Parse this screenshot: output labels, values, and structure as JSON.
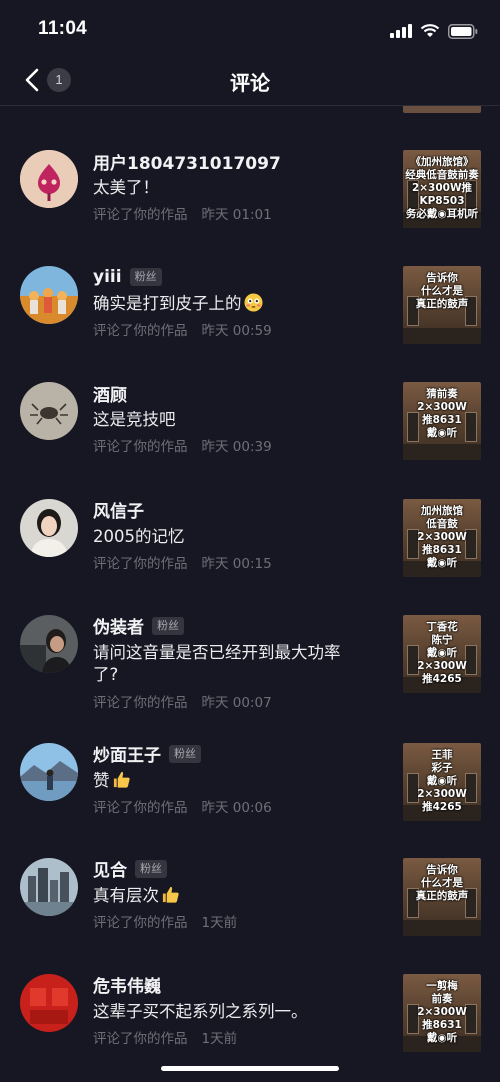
{
  "status_bar": {
    "time": "11:04"
  },
  "nav": {
    "title": "评论",
    "back_count": "1"
  },
  "comments": [
    {
      "name": "用户1804731017097",
      "fan": "",
      "text": "太美了！",
      "action": "评论了你的作品",
      "time": "昨天 01:01",
      "thumb_caption": "《加州旅馆》\n经典低音鼓前奏\n2×300W推KP8503\n务必戴◉耳机听"
    },
    {
      "name": "yiii",
      "fan": "粉丝",
      "text": "确实是打到皮子上的",
      "action": "评论了你的作品",
      "time": "昨天 00:59",
      "thumb_caption": "告诉你\n什么才是\n真正的鼓声"
    },
    {
      "name": "酒顾",
      "fan": "",
      "text": "这是竞技吧",
      "action": "评论了你的作品",
      "time": "昨天 00:39",
      "thumb_caption": "猜前奏\n2×300W\n推8631\n戴◉听"
    },
    {
      "name": "风信子",
      "fan": "",
      "text": "2005的记忆",
      "action": "评论了你的作品",
      "time": "昨天 00:15",
      "thumb_caption": "加州旅馆\n低音鼓\n2×300W\n推8631\n戴◉听"
    },
    {
      "name": "伪装者",
      "fan": "粉丝",
      "text": "请问这音量是否已经开到最大功率了?",
      "action": "评论了你的作品",
      "time": "昨天 00:07",
      "thumb_caption": "丁香花\n陈宁\n戴◉听\n2×300W\n推4265"
    },
    {
      "name": "炒面王子",
      "fan": "粉丝",
      "text": "赞",
      "action": "评论了你的作品",
      "time": "昨天 00:06",
      "thumb_caption": "王菲\n彩子\n戴◉听\n2×300W\n推4265"
    },
    {
      "name": "见合",
      "fan": "粉丝",
      "text": "真有层次",
      "action": "评论了你的作品",
      "time": "1天前",
      "thumb_caption": "告诉你\n什么才是\n真正的鼓声"
    },
    {
      "name": "危韦伟巍",
      "fan": "",
      "text": "这辈子买不起系列之系列一。",
      "action": "评论了你的作品",
      "time": "1天前",
      "thumb_caption": "一剪梅\n前奏\n2×300W\n推8631\n戴◉听"
    }
  ],
  "colors": {
    "background": "#161722",
    "secondary_text": "#6e6f78",
    "badge_bg": "#34353f"
  }
}
